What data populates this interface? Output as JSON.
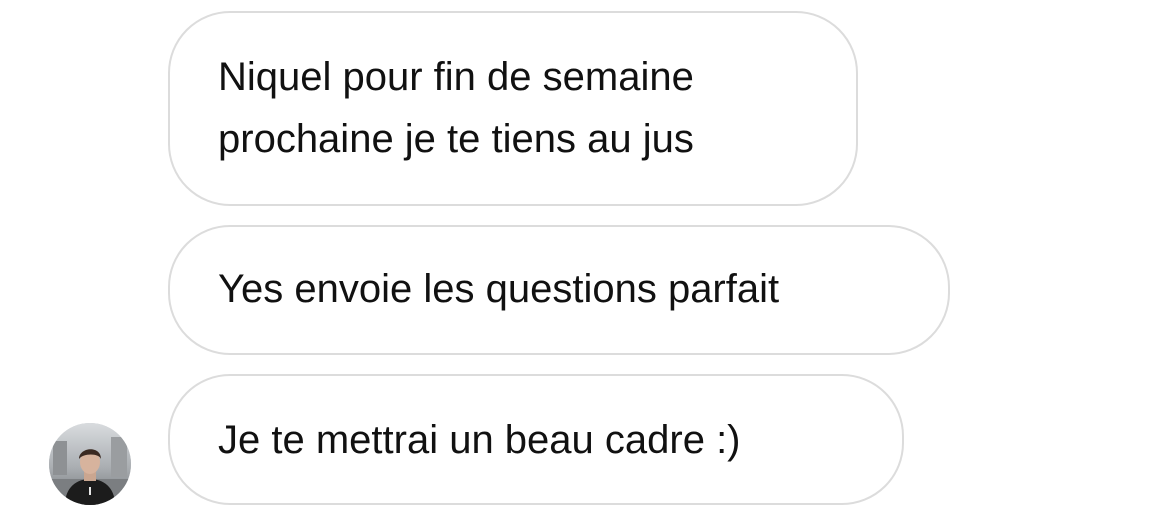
{
  "conversation": {
    "messages": [
      {
        "lines": [
          "Niquel pour fin de semaine",
          "prochaine je te tiens au jus"
        ]
      },
      {
        "text": "Yes envoie les questions parfait"
      },
      {
        "text": "Je te mettrai un beau cadre :)"
      }
    ],
    "sender_avatar": {
      "icon": "user-photo-avatar"
    }
  },
  "colors": {
    "background": "#ffffff",
    "bubble_border": "#dcdcdc",
    "text": "#111111"
  }
}
